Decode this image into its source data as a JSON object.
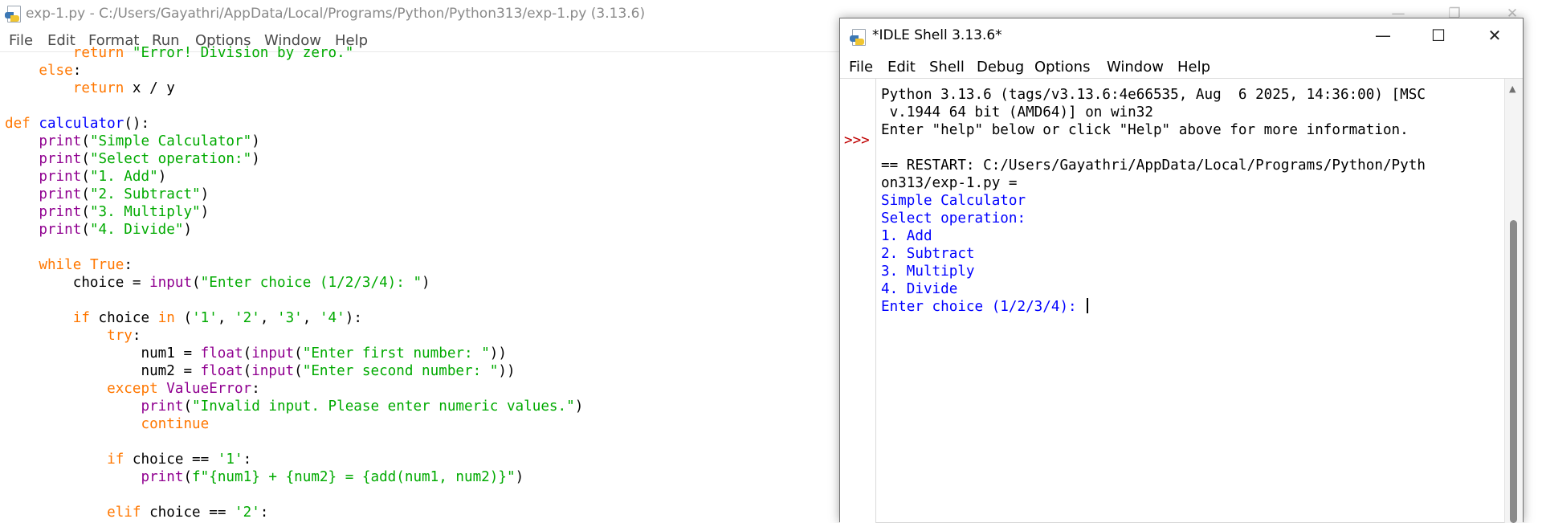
{
  "editor": {
    "title": "exp-1.py - C:/Users/Gayathri/AppData/Local/Programs/Python/Python313/exp-1.py (3.13.6)",
    "menu": [
      "File",
      "Edit",
      "Format",
      "Run",
      "Options",
      "Window",
      "Help"
    ],
    "code_lines": [
      [
        [
          "        ",
          ""
        ],
        [
          "return",
          "kw"
        ],
        [
          " ",
          ""
        ],
        [
          "\"Error! Division by zero.\"",
          "st"
        ]
      ],
      [
        [
          "    ",
          ""
        ],
        [
          "else",
          "kw"
        ],
        [
          ":",
          ""
        ]
      ],
      [
        [
          "        ",
          ""
        ],
        [
          "return",
          "kw"
        ],
        [
          " x / y",
          ""
        ]
      ],
      [],
      [
        [
          "def",
          "kw"
        ],
        [
          " ",
          ""
        ],
        [
          "calculator",
          "df"
        ],
        [
          "():",
          ""
        ]
      ],
      [
        [
          "    ",
          ""
        ],
        [
          "print",
          "bi"
        ],
        [
          "(",
          ""
        ],
        [
          "\"Simple Calculator\"",
          "st"
        ],
        [
          ")",
          ""
        ]
      ],
      [
        [
          "    ",
          ""
        ],
        [
          "print",
          "bi"
        ],
        [
          "(",
          ""
        ],
        [
          "\"Select operation:\"",
          "st"
        ],
        [
          ")",
          ""
        ]
      ],
      [
        [
          "    ",
          ""
        ],
        [
          "print",
          "bi"
        ],
        [
          "(",
          ""
        ],
        [
          "\"1. Add\"",
          "st"
        ],
        [
          ")",
          ""
        ]
      ],
      [
        [
          "    ",
          ""
        ],
        [
          "print",
          "bi"
        ],
        [
          "(",
          ""
        ],
        [
          "\"2. Subtract\"",
          "st"
        ],
        [
          ")",
          ""
        ]
      ],
      [
        [
          "    ",
          ""
        ],
        [
          "print",
          "bi"
        ],
        [
          "(",
          ""
        ],
        [
          "\"3. Multiply\"",
          "st"
        ],
        [
          ")",
          ""
        ]
      ],
      [
        [
          "    ",
          ""
        ],
        [
          "print",
          "bi"
        ],
        [
          "(",
          ""
        ],
        [
          "\"4. Divide\"",
          "st"
        ],
        [
          ")",
          ""
        ]
      ],
      [],
      [
        [
          "    ",
          ""
        ],
        [
          "while",
          "kw"
        ],
        [
          " ",
          ""
        ],
        [
          "True",
          "kw"
        ],
        [
          ":",
          ""
        ]
      ],
      [
        [
          "        choice = ",
          ""
        ],
        [
          "input",
          "bi"
        ],
        [
          "(",
          ""
        ],
        [
          "\"Enter choice (1/2/3/4): \"",
          "st"
        ],
        [
          ")",
          ""
        ]
      ],
      [],
      [
        [
          "        ",
          ""
        ],
        [
          "if",
          "kw"
        ],
        [
          " choice ",
          ""
        ],
        [
          "in",
          "kw"
        ],
        [
          " (",
          ""
        ],
        [
          "'1'",
          "st"
        ],
        [
          ", ",
          ""
        ],
        [
          "'2'",
          "st"
        ],
        [
          ", ",
          ""
        ],
        [
          "'3'",
          "st"
        ],
        [
          ", ",
          ""
        ],
        [
          "'4'",
          "st"
        ],
        [
          "):",
          ""
        ]
      ],
      [
        [
          "            ",
          ""
        ],
        [
          "try",
          "kw"
        ],
        [
          ":",
          ""
        ]
      ],
      [
        [
          "                num1 = ",
          ""
        ],
        [
          "float",
          "bi"
        ],
        [
          "(",
          ""
        ],
        [
          "input",
          "bi"
        ],
        [
          "(",
          ""
        ],
        [
          "\"Enter first number: \"",
          "st"
        ],
        [
          "))",
          ""
        ]
      ],
      [
        [
          "                num2 = ",
          ""
        ],
        [
          "float",
          "bi"
        ],
        [
          "(",
          ""
        ],
        [
          "input",
          "bi"
        ],
        [
          "(",
          ""
        ],
        [
          "\"Enter second number: \"",
          "st"
        ],
        [
          "))",
          ""
        ]
      ],
      [
        [
          "            ",
          ""
        ],
        [
          "except",
          "kw"
        ],
        [
          " ",
          ""
        ],
        [
          "ValueError",
          "bi"
        ],
        [
          ":",
          ""
        ]
      ],
      [
        [
          "                ",
          ""
        ],
        [
          "print",
          "bi"
        ],
        [
          "(",
          ""
        ],
        [
          "\"Invalid input. Please enter numeric values.\"",
          "st"
        ],
        [
          ")",
          ""
        ]
      ],
      [
        [
          "                ",
          ""
        ],
        [
          "continue",
          "kw"
        ]
      ],
      [],
      [
        [
          "            ",
          ""
        ],
        [
          "if",
          "kw"
        ],
        [
          " choice == ",
          ""
        ],
        [
          "'1'",
          "st"
        ],
        [
          ":",
          ""
        ]
      ],
      [
        [
          "                ",
          ""
        ],
        [
          "print",
          "bi"
        ],
        [
          "(",
          ""
        ],
        [
          "f\"{num1} + {num2} = {add(num1, num2)}\"",
          "st"
        ],
        [
          ")",
          ""
        ]
      ],
      [],
      [
        [
          "            ",
          ""
        ],
        [
          "elif",
          "kw"
        ],
        [
          " choice == ",
          ""
        ],
        [
          "'2'",
          "st"
        ],
        [
          ":",
          ""
        ]
      ]
    ]
  },
  "shell": {
    "title": "*IDLE Shell 3.13.6*",
    "menu": [
      "File",
      "Edit",
      "Shell",
      "Debug",
      "Options",
      "Window",
      "Help"
    ],
    "prompt": ">>>",
    "lines": [
      [
        "Python 3.13.6 (tags/v3.13.6:4e66535, Aug  6 2025, 14:36:00) [MSC",
        ""
      ],
      [
        " v.1944 64 bit (AMD64)] on win32",
        ""
      ],
      [
        "Enter \"help\" below or click \"Help\" above for more information.",
        ""
      ],
      [
        "",
        ""
      ],
      [
        "== RESTART: C:/Users/Gayathri/AppData/Local/Programs/Python/Pyth",
        ""
      ],
      [
        "on313/exp-1.py =",
        ""
      ],
      [
        "Simple Calculator",
        "out"
      ],
      [
        "Select operation:",
        "out"
      ],
      [
        "1. Add",
        "out"
      ],
      [
        "2. Subtract",
        "out"
      ],
      [
        "3. Multiply",
        "out"
      ],
      [
        "4. Divide",
        "out"
      ],
      [
        "Enter choice (1/2/3/4): ",
        "out"
      ]
    ]
  },
  "icons": {
    "app": "python-idle-icon",
    "minimize": "minimize-icon",
    "maximize": "maximize-icon",
    "restore": "restore-icon",
    "close": "close-icon"
  },
  "colors": {
    "keyword": "#ff7700",
    "builtin": "#900090",
    "string": "#00aa00",
    "definition": "#0000ff",
    "shell_output": "#0000ff",
    "prompt": "#c00000"
  }
}
